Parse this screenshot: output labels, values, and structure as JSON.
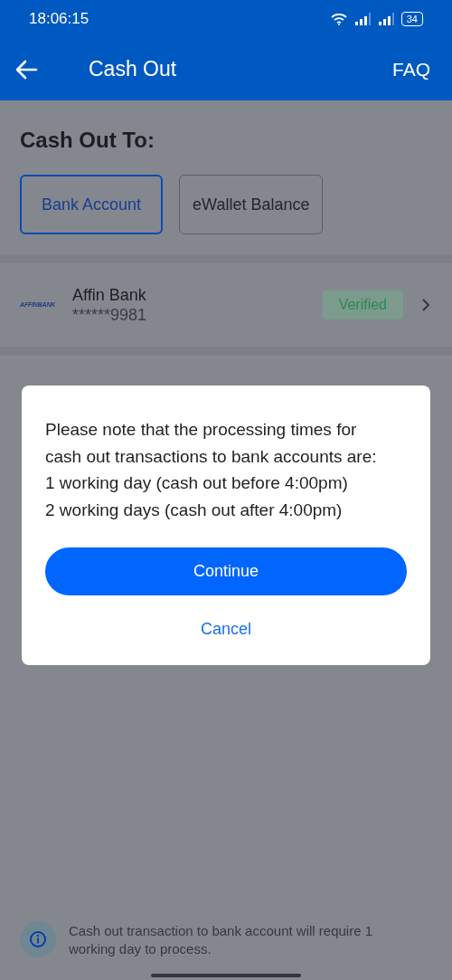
{
  "status_bar": {
    "time": "18:06:15",
    "battery": "34"
  },
  "app_bar": {
    "title": "Cash Out",
    "action": "FAQ"
  },
  "heading": "Cash Out To:",
  "tabs": [
    {
      "label": "Bank Account",
      "selected": true
    },
    {
      "label": "eWallet Balance",
      "selected": false
    }
  ],
  "bank": {
    "logo_text": "AFFINBANK",
    "name": "Affin Bank",
    "account": "******9981",
    "status": "Verified"
  },
  "dialog": {
    "lines": [
      "Please note that the processing times for cash out transactions to bank accounts are:",
      "1 working day (cash out before 4:00pm)",
      "2 working days (cash out after 4:00pm)"
    ],
    "primary": "Continue",
    "secondary": "Cancel"
  },
  "note": "Cash out transaction to bank account will require 1 working day to process."
}
